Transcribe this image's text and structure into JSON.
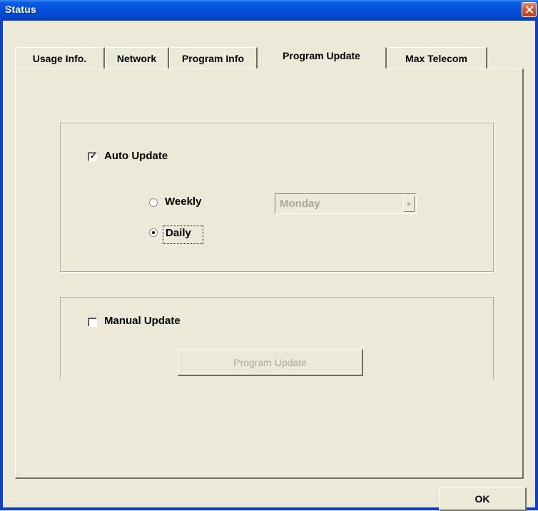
{
  "window": {
    "title": "Status"
  },
  "tabs": [
    {
      "label": "Usage Info.",
      "active": false
    },
    {
      "label": "Network",
      "active": false
    },
    {
      "label": "Program Info",
      "active": false
    },
    {
      "label": "Program Update",
      "active": true
    },
    {
      "label": "Max Telecom",
      "active": false
    }
  ],
  "auto_update": {
    "label": "Auto Update",
    "checked": true,
    "weekly_label": "Weekly",
    "daily_label": "Daily",
    "selected": "Daily",
    "day_dropdown": {
      "value": "Monday",
      "enabled": false
    }
  },
  "manual_update": {
    "label": "Manual Update",
    "checked": false,
    "button_label": "Program Update",
    "button_enabled": false
  },
  "footer": {
    "ok_label": "OK"
  },
  "colors": {
    "titlebar": "#0551dc",
    "face": "#ece9d8",
    "disabled_text": "#aca899"
  }
}
